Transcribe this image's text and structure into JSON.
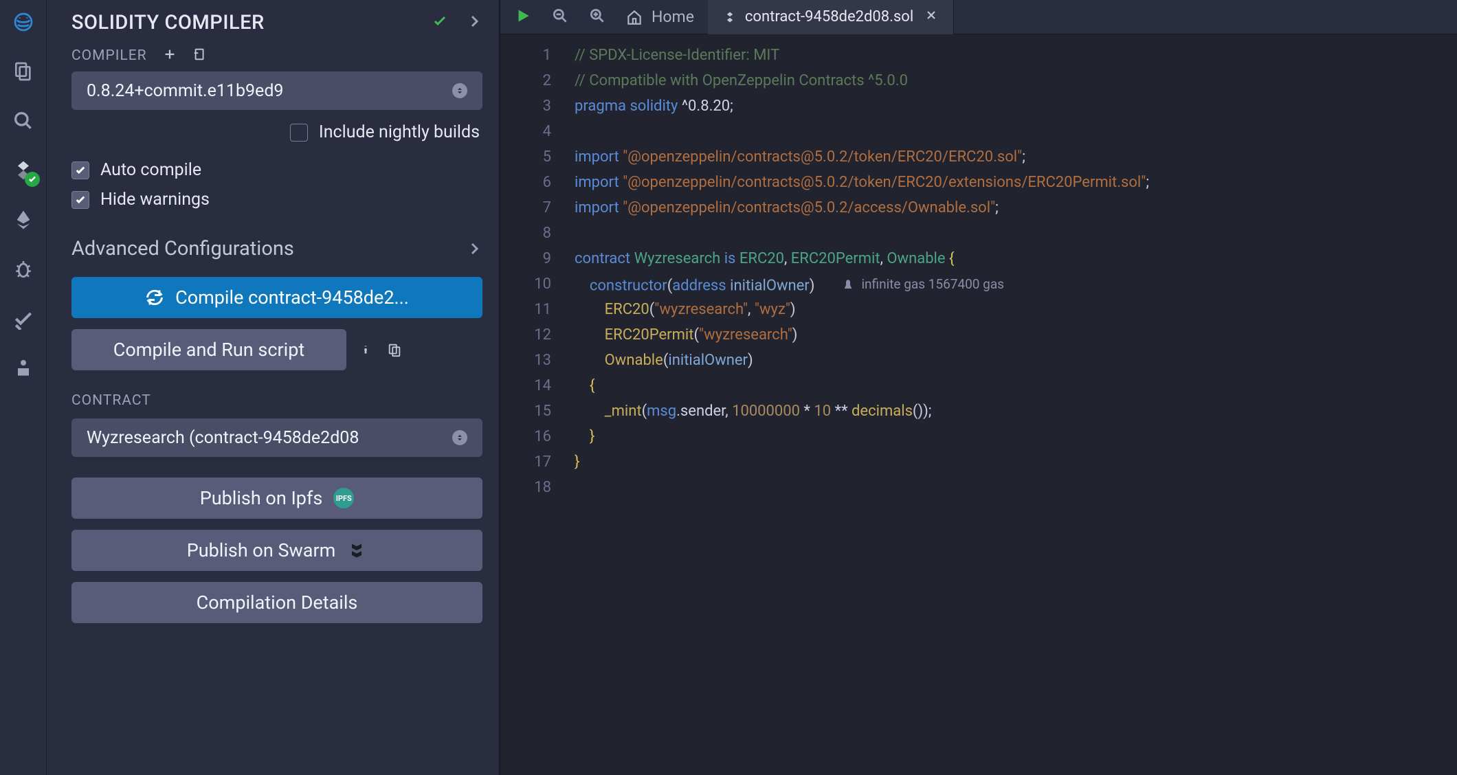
{
  "rail": {
    "items": [
      "logo",
      "files",
      "search",
      "compiler",
      "deploy",
      "debugger",
      "analysis",
      "plugin"
    ]
  },
  "panel": {
    "title": "SOLIDITY COMPILER",
    "compiler_label": "COMPILER",
    "version": "0.8.24+commit.e11b9ed9",
    "nightly_label": "Include nightly builds",
    "auto_compile_label": "Auto compile",
    "hide_warnings_label": "Hide warnings",
    "advanced_label": "Advanced Configurations",
    "compile_btn": "Compile contract-9458de2...",
    "run_btn": "Compile and Run script",
    "contract_label": "CONTRACT",
    "contract_value": "Wyzresearch (contract-9458de2d08",
    "publish_ipfs": "Publish on Ipfs",
    "ipfs_badge": "IPFS",
    "publish_swarm": "Publish on Swarm",
    "compilation_details": "Compilation Details"
  },
  "tabbar": {
    "home_label": "Home",
    "file_tab": "contract-9458de2d08.sol"
  },
  "editor": {
    "gas_hint": "infinite gas 1567400 gas",
    "lines": [
      {
        "n": 1,
        "html": "<span class=\"tok-comment\">// SPDX-License-Identifier: MIT</span>"
      },
      {
        "n": 2,
        "html": "<span class=\"tok-comment\">// Compatible with OpenZeppelin Contracts ^5.0.0</span>"
      },
      {
        "n": 3,
        "html": "<span class=\"tok-keyword\">pragma</span> <span class=\"tok-keyword\">solidity</span> ^0.8.20;"
      },
      {
        "n": 4,
        "html": ""
      },
      {
        "n": 5,
        "html": "<span class=\"tok-keyword\">import</span> <span class=\"tok-string\">\"@openzeppelin/contracts@5.0.2/token/ERC20/ERC20.sol\"</span>;"
      },
      {
        "n": 6,
        "html": "<span class=\"tok-keyword\">import</span> <span class=\"tok-string\">\"@openzeppelin/contracts@5.0.2/token/ERC20/extensions/ERC20Permit.sol\"</span>;"
      },
      {
        "n": 7,
        "html": "<span class=\"tok-keyword\">import</span> <span class=\"tok-string\">\"@openzeppelin/contracts@5.0.2/access/Ownable.sol\"</span>;"
      },
      {
        "n": 8,
        "html": ""
      },
      {
        "n": 9,
        "html": "<span class=\"tok-keyword\">contract</span> <span class=\"tok-type\">Wyzresearch</span> <span class=\"tok-keyword\">is</span> <span class=\"tok-type\">ERC20</span>, <span class=\"tok-type\">ERC20Permit</span>, <span class=\"tok-type\">Ownable</span> <span class=\"tok-brace\">{</span>"
      },
      {
        "n": 10,
        "html": "    <span class=\"tok-keyword\">constructor</span><span class=\"tok-punc\">(</span><span class=\"tok-keyword\">address</span> <span class=\"tok-var\">initialOwner</span><span class=\"tok-punc\">)</span>",
        "hint": true
      },
      {
        "n": 11,
        "html": "        <span class=\"tok-func\">ERC20</span><span class=\"tok-punc\">(</span><span class=\"tok-string\">\"wyzresearch\"</span>, <span class=\"tok-string\">\"wyz\"</span><span class=\"tok-punc\">)</span>"
      },
      {
        "n": 12,
        "html": "        <span class=\"tok-func\">ERC20Permit</span><span class=\"tok-punc\">(</span><span class=\"tok-string\">\"wyzresearch\"</span><span class=\"tok-punc\">)</span>"
      },
      {
        "n": 13,
        "html": "        <span class=\"tok-func\">Ownable</span><span class=\"tok-punc\">(</span><span class=\"tok-var\">initialOwner</span><span class=\"tok-punc\">)</span>"
      },
      {
        "n": 14,
        "html": "    <span class=\"tok-brace\">{</span>"
      },
      {
        "n": 15,
        "html": "        <span class=\"tok-func\">_mint</span><span class=\"tok-punc\">(</span><span class=\"tok-keyword\">msg</span>.sender, <span class=\"tok-num\">10000000</span> * <span class=\"tok-num\">10</span> ** <span class=\"tok-func\">decimals</span><span class=\"tok-punc\">())</span>;"
      },
      {
        "n": 16,
        "html": "    <span class=\"tok-brace\">}</span>"
      },
      {
        "n": 17,
        "html": "<span class=\"tok-brace\">}</span>"
      },
      {
        "n": 18,
        "html": ""
      }
    ]
  }
}
